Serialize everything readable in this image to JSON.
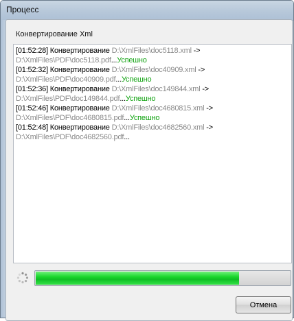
{
  "window": {
    "title": "Процесс"
  },
  "group": {
    "title": "Конвертирование Xml"
  },
  "log": {
    "entries": [
      {
        "time": "[01:52:28]",
        "action": "Конвертирование",
        "source": "D:\\XmlFiles\\doc5118.xml",
        "arrow": "->",
        "target": "D:\\XmlFiles\\PDF\\doc5118.pdf",
        "ellipsis": "...",
        "status": "Успешно"
      },
      {
        "time": "[01:52:32]",
        "action": "Конвертирование",
        "source": "D:\\XmlFiles\\doc40909.xml",
        "arrow": "->",
        "target": "D:\\XmlFiles\\PDF\\doc40909.pdf",
        "ellipsis": "...",
        "status": "Успешно"
      },
      {
        "time": "[01:52:36]",
        "action": "Конвертирование",
        "source": "D:\\XmlFiles\\doc149844.xml",
        "arrow": "->",
        "target": "D:\\XmlFiles\\PDF\\doc149844.pdf",
        "ellipsis": "...",
        "status": "Успешно"
      },
      {
        "time": "[01:52:46]",
        "action": "Конвертирование",
        "source": "D:\\XmlFiles\\doc4680815.xml",
        "arrow": "->",
        "target": "D:\\XmlFiles\\PDF\\doc4680815.pdf",
        "ellipsis": "...",
        "status": "Успешно"
      },
      {
        "time": "[01:52:48]",
        "action": "Конвертирование",
        "source": "D:\\XmlFiles\\doc4682560.xml",
        "arrow": "->",
        "target": "D:\\XmlFiles\\PDF\\doc4682560.pdf",
        "ellipsis": "...",
        "status": ""
      }
    ]
  },
  "progress": {
    "fraction": 0.8
  },
  "buttons": {
    "cancel_label": "Отмена"
  },
  "icons": {
    "spinner": "loading-spinner-icon"
  },
  "colors": {
    "success": "#12a312",
    "path": "#8a8a8a",
    "progress": "#19d62c"
  }
}
